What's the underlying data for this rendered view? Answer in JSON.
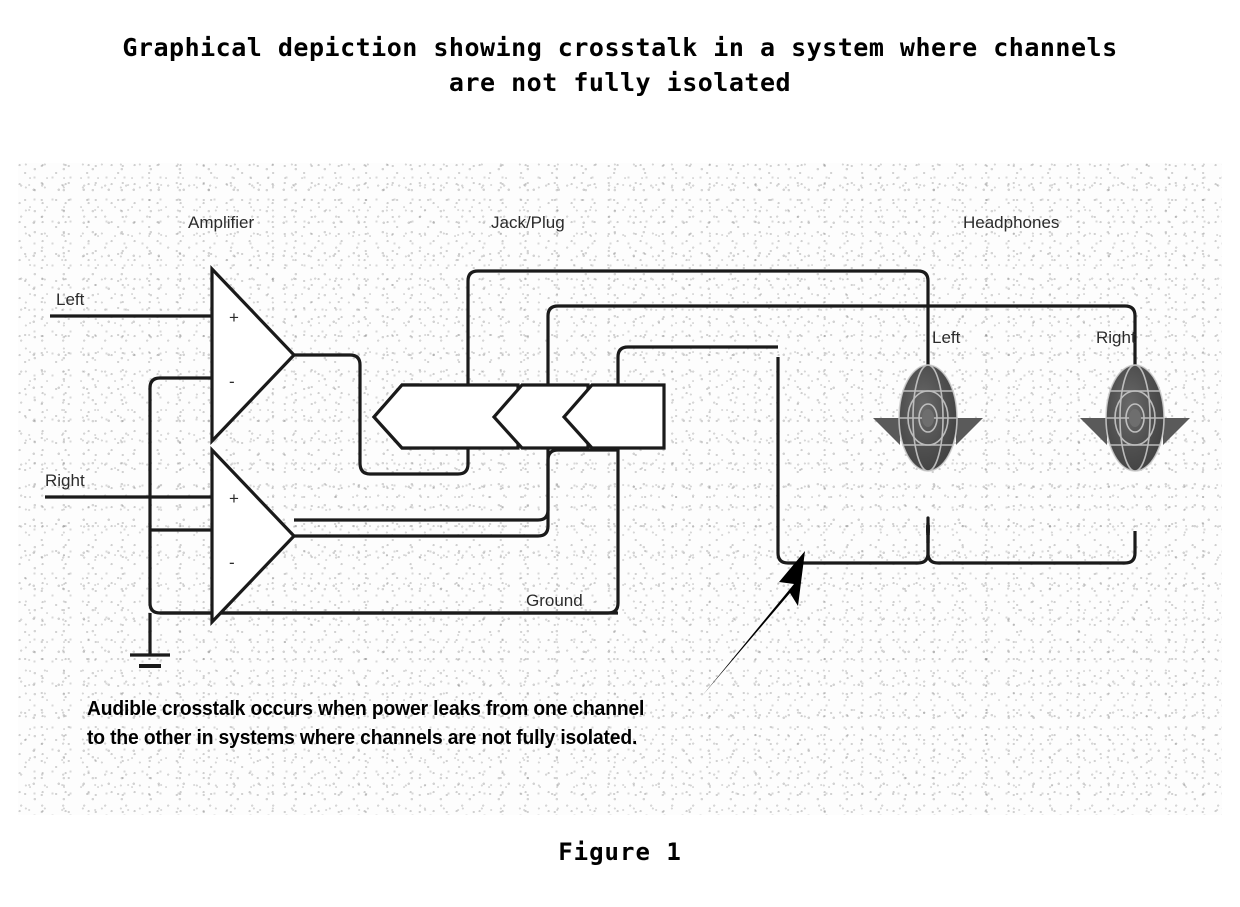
{
  "page": {
    "title": "Graphical depiction showing crosstalk in a system where channels\nare not fully isolated",
    "figure_label": "Figure 1",
    "caption": "Audible crosstalk occurs when power leaks from one channel\nto the other in systems where channels are not fully isolated."
  },
  "diagram": {
    "section_labels": {
      "amplifier": "Amplifier",
      "jack_plug": "Jack/Plug",
      "headphones": "Headphones"
    },
    "input_labels": {
      "left": "Left",
      "right": "Right"
    },
    "driver_labels": {
      "left": "Left",
      "right": "Right"
    },
    "ground_label": "Ground",
    "amplifier_terminals": {
      "positive": "+",
      "negative": "-"
    },
    "colors": {
      "wire": "#1a1a1a",
      "text": "#2b2b2b",
      "driver_body": "#4d4d4d",
      "driver_highlight": "#d8d8d8",
      "background": "#fdfdfd",
      "arrow": "#000000"
    }
  }
}
